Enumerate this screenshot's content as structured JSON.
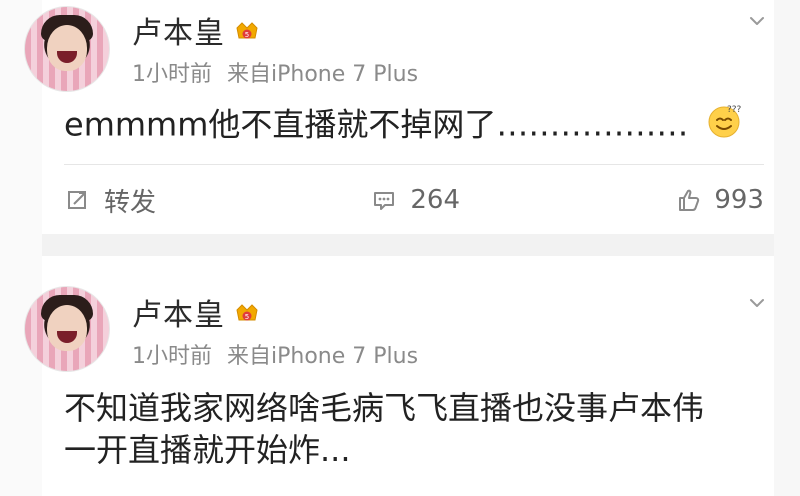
{
  "posts": [
    {
      "author": "卢本皇",
      "time": "1小时前",
      "source": "来自iPhone 7 Plus",
      "text": "emmmm他不直播就不掉网了………………",
      "actions": {
        "repost_label": "转发",
        "comment_count": "264",
        "like_count": "993"
      }
    },
    {
      "author": "卢本皇",
      "time": "1小时前",
      "source": "来自iPhone 7 Plus",
      "text_line1": "不知道我家网络啥毛病飞飞直播也没事卢本伟",
      "text_line2": "一开直播就开始炸..."
    }
  ],
  "icons": {
    "vip": "vip-crown-badge-icon",
    "chevron": "chevron-down-icon",
    "repost": "repost-icon",
    "comment": "comment-icon",
    "like": "like-icon",
    "emoji": "sweat-smile-emoji-icon"
  },
  "colors": {
    "text": "#222222",
    "meta": "#8a8a8a",
    "action": "#666666",
    "badge_gold": "#f2a900",
    "badge_red": "#e03b3b"
  }
}
